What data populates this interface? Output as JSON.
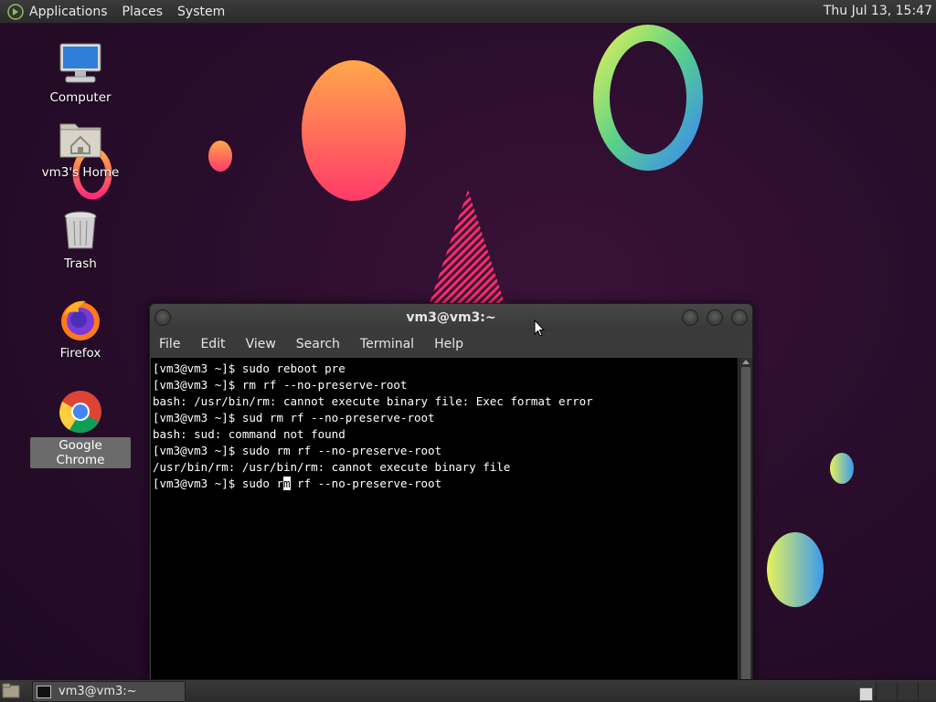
{
  "top_panel": {
    "menus": [
      "Applications",
      "Places",
      "System"
    ],
    "clock": "Thu Jul 13, 15:47"
  },
  "desktop_icons": [
    {
      "label": "Computer",
      "icon": "computer-icon"
    },
    {
      "label": "vm3's Home",
      "icon": "home-folder-icon"
    },
    {
      "label": "Trash",
      "icon": "trash-icon"
    },
    {
      "label": "Firefox",
      "icon": "firefox-icon"
    },
    {
      "label": "Google Chrome",
      "icon": "chrome-icon",
      "selected": true
    }
  ],
  "terminal": {
    "title": "vm3@vm3:~",
    "menu": [
      "File",
      "Edit",
      "View",
      "Search",
      "Terminal",
      "Help"
    ],
    "lines": [
      "[vm3@vm3 ~]$ sudo reboot pre",
      "[vm3@vm3 ~]$ rm rf --no-preserve-root",
      "bash: /usr/bin/rm: cannot execute binary file: Exec format error",
      "[vm3@vm3 ~]$ sud rm rf --no-preserve-root",
      "bash: sud: command not found",
      "[vm3@vm3 ~]$ sudo rm rf --no-preserve-root",
      "/usr/bin/rm: /usr/bin/rm: cannot execute binary file"
    ],
    "current_line_before_cursor": "[vm3@vm3 ~]$ sudo r",
    "cursor_char": "m",
    "current_line_after_cursor": " rf --no-preserve-root"
  },
  "taskbar": {
    "task_label": "vm3@vm3:~"
  }
}
